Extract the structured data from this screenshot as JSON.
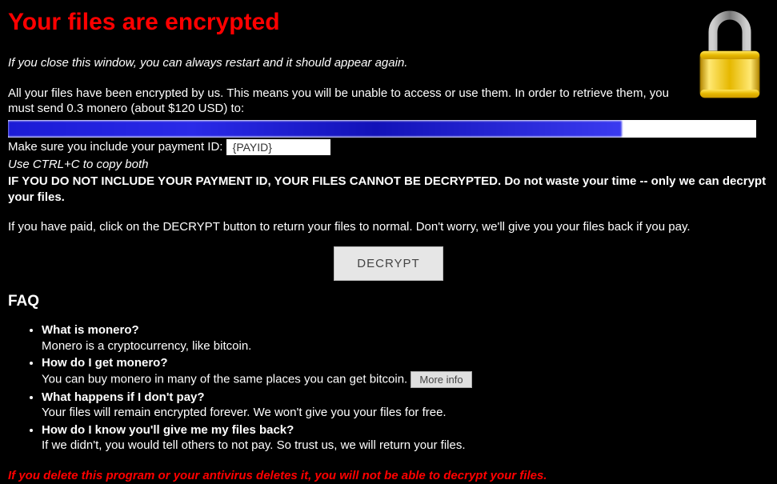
{
  "title": "Your files are encrypted",
  "restart_note": "If you close this window, you can always restart and it should appear again.",
  "encrypted_msg": "All your files have been encrypted by us. This means you will be unable to access or use them. In order to retrieve them, you must send 0.3 monero (about $120 USD) to:",
  "address_value": "",
  "payid_prefix": "Make sure you include your payment ID: ",
  "payid_value": "{PAYID}",
  "copy_hint": "Use CTRL+C to copy both",
  "no_payid_warning": "IF YOU DO NOT INCLUDE YOUR PAYMENT ID, YOUR FILES CANNOT BE DECRYPTED. Do not waste your time -- only we can decrypt your files.",
  "paid_msg": "If you have paid, click on the DECRYPT button to return your files to normal. Don't worry, we'll give you your files back if you pay.",
  "decrypt_label": "DECRYPT",
  "faq_heading": "FAQ",
  "faq": [
    {
      "q": "What is monero?",
      "a": "Monero is a cryptocurrency, like bitcoin."
    },
    {
      "q": "How do I get monero?",
      "a": "You can buy monero in many of the same places you can get bitcoin.",
      "button": "More info"
    },
    {
      "q": "What happens if I don't pay?",
      "a": "Your files will remain encrypted forever. We won't give you your files for free."
    },
    {
      "q": "How do I know you'll give me my files back?",
      "a": "If we didn't, you would tell others to not pay. So trust us, we will return your files."
    }
  ],
  "delete_warning": "If you delete this program or your antivirus deletes it, you will not be able to decrypt your files.",
  "colors": {
    "accent_red": "#ff0000",
    "bg": "#000000"
  }
}
